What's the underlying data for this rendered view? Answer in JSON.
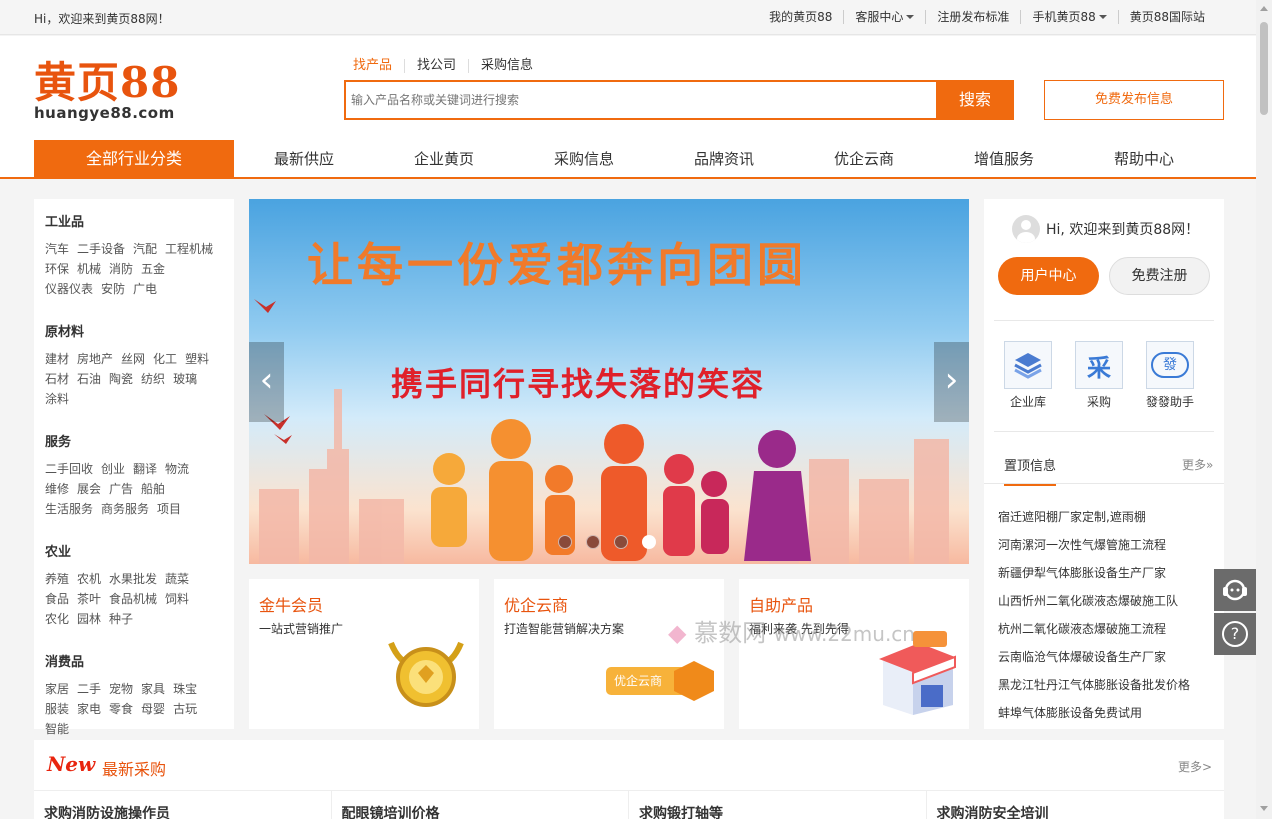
{
  "topbar": {
    "greeting": "Hi，欢迎来到黄页88网！",
    "links": [
      "我的黄页88",
      "客服中心",
      "注册发布标准",
      "手机黄页88",
      "黄页88国际站"
    ]
  },
  "logo": {
    "cn": "黄页88",
    "domain": "huangye88.com"
  },
  "search": {
    "tabs": [
      "找产品",
      "找公司",
      "采购信息"
    ],
    "placeholder": "输入产品名称或关键词进行搜索",
    "button": "搜索"
  },
  "publish_button": "免费发布信息",
  "nav": {
    "all": "全部行业分类",
    "items": [
      "最新供应",
      "企业黄页",
      "采购信息",
      "品牌资讯",
      "优企云商",
      "增值服务",
      "帮助中心"
    ]
  },
  "categories": [
    {
      "title": "工业品",
      "items": [
        "汽车",
        "二手设备",
        "汽配",
        "工程机械",
        "环保",
        "机械",
        "消防",
        "五金",
        "仪器仪表",
        "安防",
        "广电"
      ]
    },
    {
      "title": "原材料",
      "items": [
        "建材",
        "房地产",
        "丝网",
        "化工",
        "塑料",
        "石材",
        "石油",
        "陶瓷",
        "纺织",
        "玻璃",
        "涂料"
      ]
    },
    {
      "title": "服务",
      "items": [
        "二手回收",
        "创业",
        "翻译",
        "物流",
        "维修",
        "展会",
        "广告",
        "船舶",
        "生活服务",
        "商务服务",
        "项目"
      ]
    },
    {
      "title": "农业",
      "items": [
        "养殖",
        "农机",
        "水果批发",
        "蔬菜",
        "食品",
        "茶叶",
        "食品机械",
        "饲料",
        "农化",
        "园林",
        "种子"
      ]
    },
    {
      "title": "消费品",
      "items": [
        "家居",
        "二手",
        "宠物",
        "家具",
        "珠宝",
        "服装",
        "家电",
        "零食",
        "母婴",
        "古玩",
        "智能"
      ]
    }
  ],
  "banner": {
    "line1": "让每一份爱都奔向团圆",
    "line2": "携手同行寻找失落的笑容"
  },
  "cards": [
    {
      "title": "金牛会员",
      "desc": "一站式营销推广"
    },
    {
      "title": "优企云商",
      "desc": "打造智能营销解决方案",
      "badge": "优企云商"
    },
    {
      "title": "自助产品",
      "desc": "福利来袭 先到先得"
    }
  ],
  "user": {
    "greeting": "Hi, 欢迎来到黄页88网！",
    "center": "用户中心",
    "register": "免费注册"
  },
  "quick_icons": [
    {
      "label": "企业库",
      "icon": "layers-icon"
    },
    {
      "label": "采购",
      "icon": "cai-icon",
      "glyph": "采"
    },
    {
      "label": "發發助手",
      "icon": "fafa-cloud-icon",
      "glyph": "發"
    }
  ],
  "top_info": {
    "tab": "置顶信息",
    "more": "更多»",
    "items": [
      "宿迁遮阳棚厂家定制,遮雨棚",
      "河南漯河一次性气爆管施工流程",
      "新疆伊犁气体膨胀设备生产厂家",
      "山西忻州二氧化碳液态爆破施工队",
      "杭州二氧化碳液态爆破施工流程",
      "云南临沧气体爆破设备生产厂家",
      "黑龙江牡丹江气体膨胀设备批发价格",
      "蚌埠气体膨胀设备免费试用"
    ]
  },
  "latest": {
    "new_tag": "New",
    "title": "最新采购",
    "more": "更多>",
    "items": [
      "求购消防设施操作员",
      "配眼镜培训价格",
      "求购锻打轴等",
      "求购消防安全培训"
    ]
  },
  "watermark": {
    "text": "慕数网",
    "url": "www.22mu.cn"
  },
  "colors": {
    "accent": "#f06a0f",
    "accent_dark": "#e8540e",
    "new_red": "#e8240e"
  }
}
